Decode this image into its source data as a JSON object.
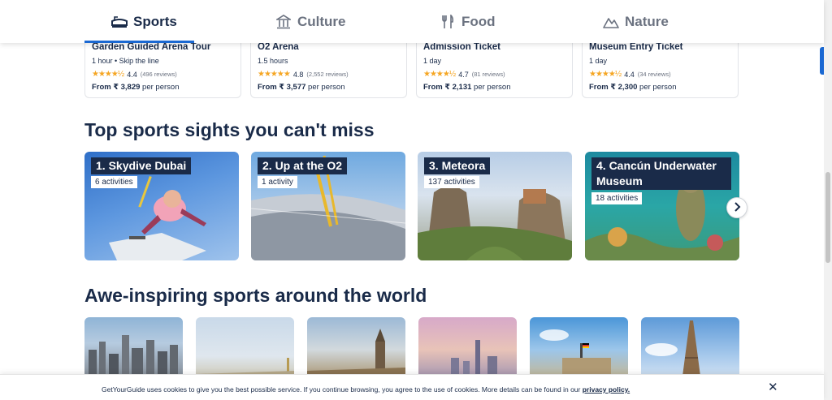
{
  "categories": [
    {
      "label": "Sports",
      "icon": "stadium-icon",
      "active": true
    },
    {
      "label": "Culture",
      "icon": "museum-icon",
      "active": false
    },
    {
      "label": "Food",
      "icon": "utensils-icon",
      "active": false
    },
    {
      "label": "Nature",
      "icon": "mountain-icon",
      "active": false
    }
  ],
  "activities": [
    {
      "title": "Garden Guided Arena Tour",
      "meta": "1 hour • Skip the line",
      "rating": "4.4",
      "stars": "★★★★½",
      "reviews": "(496 reviews)",
      "price_prefix": "From ₹ 3,829",
      "price_unit": " per person"
    },
    {
      "title": "O2 Arena",
      "meta": "1.5 hours",
      "rating": "4.8",
      "stars": "★★★★★",
      "reviews": "(2,552 reviews)",
      "price_prefix": "From ₹ 3,577",
      "price_unit": " per person"
    },
    {
      "title": "Admission Ticket",
      "meta": "1 day",
      "rating": "4.7",
      "stars": "★★★★½",
      "reviews": "(81 reviews)",
      "price_prefix": "From ₹ 2,131",
      "price_unit": " per person"
    },
    {
      "title": "Museum Entry Ticket",
      "meta": "1 day",
      "rating": "4.4",
      "stars": "★★★★½",
      "reviews": "(34 reviews)",
      "price_prefix": "From ₹ 2,300",
      "price_unit": " per person"
    }
  ],
  "sights_section": {
    "title": "Top sports sights you can't miss",
    "items": [
      {
        "label": "1. Skydive Dubai",
        "count": "6 activities"
      },
      {
        "label": "2. Up at the O2",
        "count": "1 activity"
      },
      {
        "label": "3. Meteora",
        "count": "137 activities"
      },
      {
        "label": "4. Cancún Underwater Museum",
        "count": "18 activities"
      }
    ]
  },
  "world_section": {
    "title": "Awe-inspiring sports around the world"
  },
  "cookie": {
    "text": "GetYourGuide uses cookies to give you the best possible service. If you continue browsing, you agree to the use of cookies. More details can be found in our ",
    "link": "privacy policy.",
    "close": "✕"
  },
  "colors": {
    "brand_blue": "#1a68d2",
    "navy": "#1a2b49",
    "star": "#f5a623"
  }
}
